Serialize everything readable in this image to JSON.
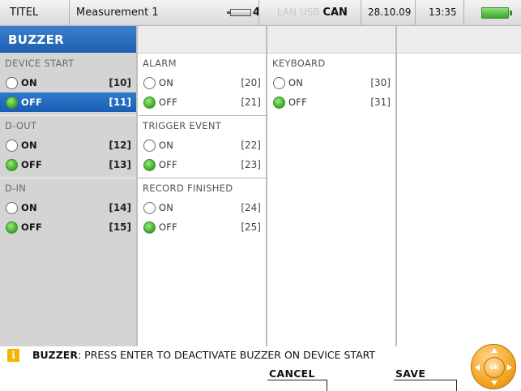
{
  "status_bar": {
    "title": "TITEL",
    "measurement": "Measurement 1",
    "battery_count": "4",
    "interfaces_dim": "LAN USB",
    "interface_active": "CAN",
    "date": "28.10.09",
    "time": "13:35",
    "power_icon": "battery-full-icon",
    "power_color": "#3ea52c"
  },
  "page": {
    "title": "BUZZER",
    "accent_color": "#2f79cc"
  },
  "columns": [
    {
      "groups": [
        {
          "title": "DEVICE START",
          "options": [
            {
              "label": "ON",
              "key": "[10]",
              "checked": false,
              "selected": false
            },
            {
              "label": "OFF",
              "key": "[11]",
              "checked": true,
              "selected": true
            }
          ]
        },
        {
          "title": "D-OUT",
          "options": [
            {
              "label": "ON",
              "key": "[12]",
              "checked": false,
              "selected": false
            },
            {
              "label": "OFF",
              "key": "[13]",
              "checked": true,
              "selected": false
            }
          ]
        },
        {
          "title": "D-IN",
          "options": [
            {
              "label": "ON",
              "key": "[14]",
              "checked": false,
              "selected": false
            },
            {
              "label": "OFF",
              "key": "[15]",
              "checked": true,
              "selected": false
            }
          ]
        }
      ]
    },
    {
      "groups": [
        {
          "title": "ALARM",
          "options": [
            {
              "label": "ON",
              "key": "[20]",
              "checked": false,
              "selected": false
            },
            {
              "label": "OFF",
              "key": "[21]",
              "checked": true,
              "selected": false
            }
          ]
        },
        {
          "title": "TRIGGER EVENT",
          "options": [
            {
              "label": "ON",
              "key": "[22]",
              "checked": false,
              "selected": false
            },
            {
              "label": "OFF",
              "key": "[23]",
              "checked": true,
              "selected": false
            }
          ]
        },
        {
          "title": "RECORD FINISHED",
          "options": [
            {
              "label": "ON",
              "key": "[24]",
              "checked": false,
              "selected": false
            },
            {
              "label": "OFF",
              "key": "[25]",
              "checked": true,
              "selected": false
            }
          ]
        }
      ]
    },
    {
      "groups": [
        {
          "title": "KEYBOARD",
          "options": [
            {
              "label": "ON",
              "key": "[30]",
              "checked": false,
              "selected": false
            },
            {
              "label": "OFF",
              "key": "[31]",
              "checked": true,
              "selected": false
            }
          ]
        }
      ]
    }
  ],
  "info": {
    "icon": "info-icon",
    "icon_glyph": "i",
    "label": "BUZZER",
    "message": ": PRESS ENTER TO DEACTIVATE BUZZER ON DEVICE START"
  },
  "softkeys": {
    "cancel": "CANCEL",
    "save": "SAVE"
  },
  "nav": {
    "center_label": "ok"
  }
}
